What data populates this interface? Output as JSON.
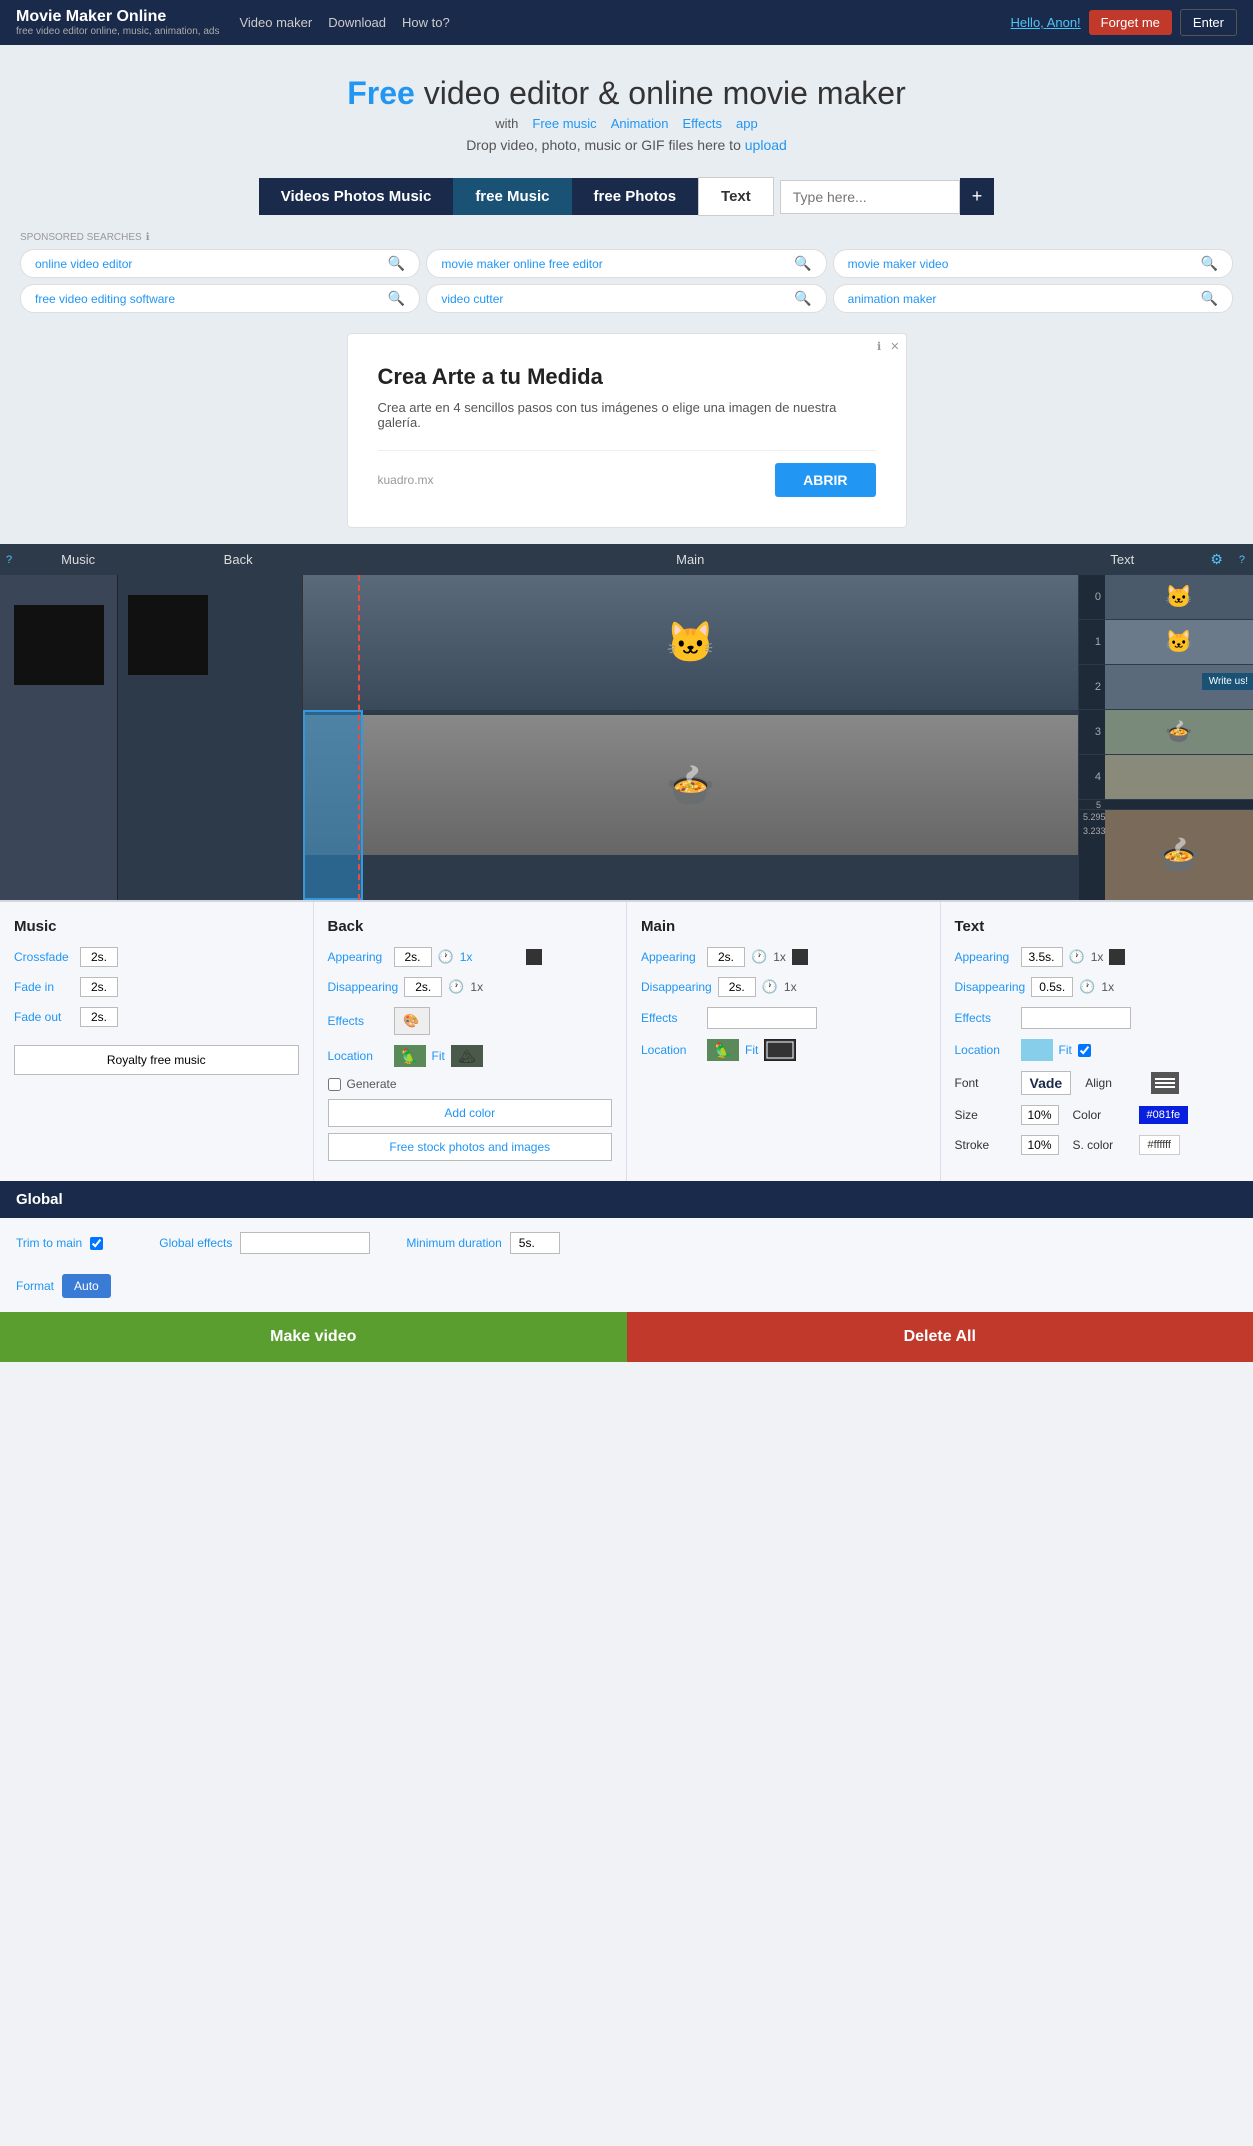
{
  "header": {
    "brand_title": "Movie Maker Online",
    "brand_sub": "free video editor online, music, animation, ads",
    "nav": [
      "Video maker",
      "Download",
      "How to?"
    ],
    "hello_text": "Hello, ",
    "hello_user": "Anon!",
    "btn_forget": "Forget me",
    "btn_enter": "Enter"
  },
  "hero": {
    "title_free": "Free",
    "title_rest": " video editor & online movie maker",
    "with_text": "with",
    "links": [
      "Free music",
      "Animation",
      "Effects",
      "app"
    ],
    "drop_text": "Drop video, photo, music or GIF files here to",
    "drop_link": "upload"
  },
  "tabs": [
    {
      "label": "Videos Photos Music",
      "style": "active-dark"
    },
    {
      "label": "free Music",
      "style": "active-blue"
    },
    {
      "label": "free Photos",
      "style": "active-navy"
    },
    {
      "label": "Text",
      "style": "text-tab"
    }
  ],
  "search": {
    "placeholder": "Type here...",
    "btn": "+"
  },
  "sponsored": {
    "label": "SPONSORED SEARCHES",
    "info": "ℹ",
    "items": [
      "online video editor",
      "movie maker online free editor",
      "movie maker video",
      "free video editing software",
      "video cutter",
      "animation maker"
    ]
  },
  "ad": {
    "close_btn": "✕",
    "info_icon": "ℹ",
    "title": "Crea Arte a tu Medida",
    "body": "Crea arte en 4 sencillos pasos con tus imágenes o elige una imagen de nuestra galería.",
    "source": "kuadro.mx",
    "btn_label": "ABRIR"
  },
  "editor_tabs": {
    "question": "?",
    "tabs": [
      "Music",
      "Back",
      "Main",
      "Text"
    ],
    "gear_icon": "⚙"
  },
  "ruler": {
    "marks": [
      "0",
      "1",
      "2",
      "3",
      "4",
      "5"
    ],
    "position1": "5.295",
    "position2": "3.233"
  },
  "write_us": "Write us!",
  "music_panel": {
    "title": "Music",
    "crossfade_label": "Crossfade",
    "crossfade_val": "2s.",
    "fade_in_label": "Fade in",
    "fade_in_val": "2s.",
    "fade_out_label": "Fade out",
    "fade_out_val": "2s.",
    "btn_royalty": "Royalty free music"
  },
  "back_panel": {
    "title": "Back",
    "appearing_label": "Appearing",
    "appearing_val": "2s.",
    "disappearing_label": "Disappearing",
    "disappearing_val": "2s.",
    "effects_label": "Effects",
    "location_label": "Location",
    "fit_label": "Fit",
    "generate_label": "Generate",
    "btn_add_color": "Add color",
    "btn_free_stock": "Free stock photos and images",
    "multiplier": "1x"
  },
  "main_panel": {
    "title": "Main",
    "appearing_label": "Appearing",
    "appearing_val": "2s.",
    "disappearing_label": "Disappearing",
    "disappearing_val": "2s.",
    "effects_label": "Effects",
    "location_label": "Location",
    "fit_label": "Fit",
    "multiplier": "1x"
  },
  "text_panel": {
    "title": "Text",
    "appearing_label": "Appearing",
    "appearing_val": "3.5s.",
    "disappearing_label": "Disappearing",
    "disappearing_val": "0.5s.",
    "effects_label": "Effects",
    "location_label": "Location",
    "fit_label": "Fit",
    "font_label": "Font",
    "font_name": "Vade",
    "align_label": "Align",
    "size_label": "Size",
    "size_val": "10%",
    "color_label": "Color",
    "color_val": "#081fe",
    "stroke_label": "Stroke",
    "stroke_val": "10%",
    "s_color_label": "S. color",
    "s_color_val": "#ffffff",
    "multiplier": "1x"
  },
  "global": {
    "title": "Global",
    "trim_label": "Trim to main",
    "global_effects_label": "Global effects",
    "min_duration_label": "Minimum duration",
    "min_duration_val": "5s.",
    "format_label": "Format",
    "format_val": "Auto"
  },
  "footer": {
    "make_video": "Make video",
    "delete_all": "Delete All"
  }
}
